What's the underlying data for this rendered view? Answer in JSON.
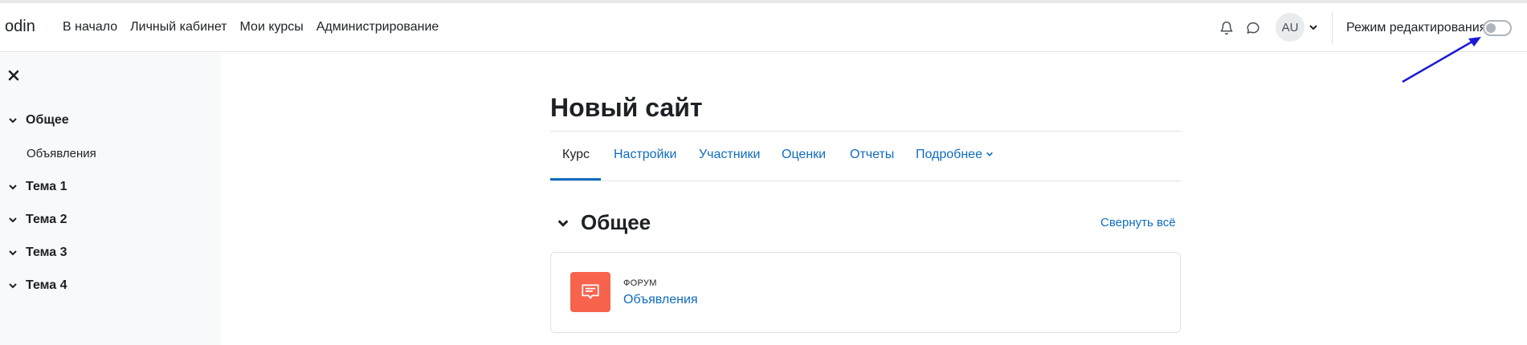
{
  "header": {
    "brand": "odin",
    "nav": [
      "В начало",
      "Личный кабинет",
      "Мои курсы",
      "Администрирование"
    ],
    "avatar_initials": "AU",
    "edit_mode_label": "Режим редактирования",
    "edit_mode_on": false
  },
  "sidebar": {
    "sections": [
      {
        "label": "Общее",
        "children": [
          "Объявления"
        ]
      },
      {
        "label": "Тема 1",
        "children": []
      },
      {
        "label": "Тема 2",
        "children": []
      },
      {
        "label": "Тема 3",
        "children": []
      },
      {
        "label": "Тема 4",
        "children": []
      }
    ]
  },
  "main": {
    "title": "Новый сайт",
    "tabs": [
      "Курс",
      "Настройки",
      "Участники",
      "Оценки",
      "Отчеты",
      "Подробнее"
    ],
    "active_tab": "Курс",
    "section_title": "Общее",
    "collapse_all": "Свернуть всё",
    "activity": {
      "type": "ФОРУМ",
      "name": "Объявления"
    }
  },
  "colors": {
    "accent": "#0f6cbf",
    "forum_icon": "#f7634d",
    "sidebar_bg": "#f8f9fa",
    "annotation_arrow": "#1a1ad6"
  },
  "icons": [
    "bell-icon",
    "chat-icon",
    "chevron-down-icon",
    "close-icon",
    "forum-icon"
  ]
}
